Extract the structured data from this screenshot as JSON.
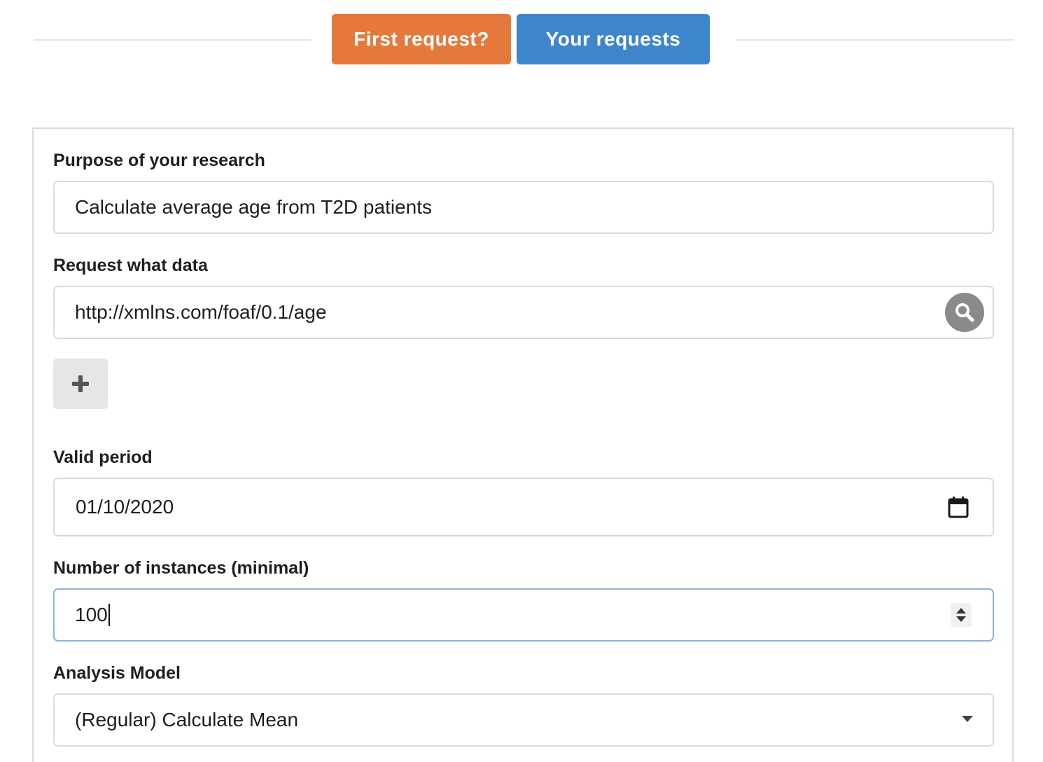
{
  "top_buttons": {
    "first_request": "First request?",
    "your_requests": "Your requests",
    "first_request_color": "#e5793b",
    "your_requests_color": "#3e86cc"
  },
  "form": {
    "purpose": {
      "label": "Purpose of your research",
      "value": "Calculate average age from T2D patients"
    },
    "request_data": {
      "label": "Request what data",
      "value": "http://xmlns.com/foaf/0.1/age",
      "search_icon": "search-icon"
    },
    "add_button": {
      "icon": "plus-icon"
    },
    "valid_period": {
      "label": "Valid period",
      "value": "01/10/2020",
      "icon": "calendar-icon"
    },
    "instances": {
      "label": "Number of instances (minimal)",
      "value": "100"
    },
    "analysis_model": {
      "label": "Analysis Model",
      "value": "(Regular) Calculate Mean"
    }
  }
}
